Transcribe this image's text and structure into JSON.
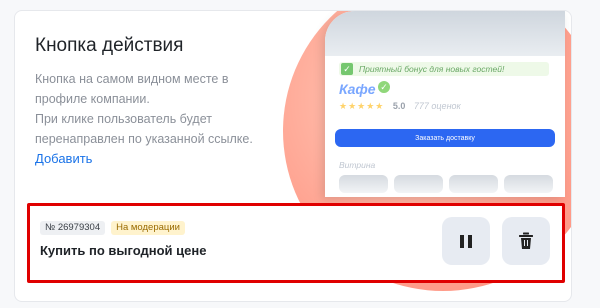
{
  "promo": {
    "title": "Кнопка действия",
    "description_lines": [
      "Кнопка на самом видном месте в",
      "профиле компании.",
      "При клике пользователь будет",
      "перенаправлен по указанной ссылке."
    ],
    "add_link": "Добавить"
  },
  "preview": {
    "bonus_text": "Приятный бонус для новых гостей!",
    "cafe_name": "Кафе",
    "rating_value": "5.0",
    "reviews_text": "777 оценок",
    "stars": 5,
    "order_button": "Заказать доставку",
    "section_title": "Витрина"
  },
  "action_button": {
    "id_badge": "№ 26979304",
    "status_badge": "На модерации",
    "label": "Купить по выгодной цене"
  },
  "icons": {
    "pause": "pause-icon",
    "trash": "trash-icon",
    "bonus": "bonus-icon",
    "verified": "verified-icon"
  },
  "colors": {
    "link": "#1a73e8",
    "accent": "#2c67f2",
    "highlight_border": "#e00000",
    "status_badge_bg": "#fff3cd"
  }
}
